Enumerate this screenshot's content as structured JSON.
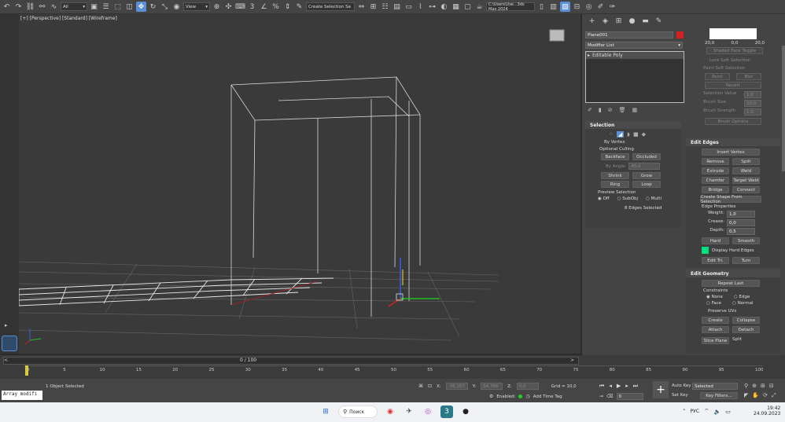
{
  "toolbar": {
    "selection_filter": "All",
    "ref_coord": "View",
    "named_selection": "Create Selection Se",
    "project_path": "C:\\Users\\Use...3ds Max 2024"
  },
  "viewport": {
    "label": "[+] [Perspective] [Standard] [Wireframe]"
  },
  "command_panel": {
    "object_name": "Plane001",
    "object_color": "#d42020",
    "modifier_list": "Modifier List",
    "stack_item": "Editable Poly",
    "selection": {
      "title": "Selection",
      "by_vertex": "By Vertex",
      "optional_culling": "Optional Culling",
      "backface": "Backface",
      "occluded": "Occluded",
      "by_angle": "By Angle:",
      "by_angle_value": "45,0",
      "shrink": "Shrink",
      "grow": "Grow",
      "ring": "Ring",
      "loop": "Loop",
      "preview_selection": "Preview Selection",
      "off": "Off",
      "subobj": "SubObj",
      "multi": "Multi",
      "status": "8 Edges Selected"
    },
    "soft_selection": {
      "values": [
        "20,0",
        "0,0",
        "20,0"
      ],
      "shaded_face_toggle": "Shaded Face Toggle",
      "lock_soft_selection": "Lock Soft Selection",
      "paint_soft_selection": "Paint Soft Selection",
      "paint": "Paint",
      "blur": "Blur",
      "revert": "Revert",
      "selection_value": "Selection Value",
      "selection_value_num": "1,0",
      "brush_size": "Brush Size",
      "brush_size_num": "20,0",
      "brush_strength": "Brush Strength",
      "brush_strength_num": "1,0",
      "brush_options": "Brush Options"
    },
    "edit_edges": {
      "title": "Edit Edges",
      "insert_vertex": "Insert Vertex",
      "remove": "Remove",
      "split": "Split",
      "extrude": "Extrude",
      "weld": "Weld",
      "chamfer": "Chamfer",
      "target_weld": "Target Weld",
      "bridge": "Bridge",
      "connect": "Connect",
      "create_shape": "Create Shape From Selection",
      "edge_properties": "Edge Properties",
      "weight": "Weight:",
      "weight_val": "1,0",
      "crease": "Crease:",
      "crease_val": "0,0",
      "depth": "Depth:",
      "depth_val": "0,5",
      "hard": "Hard",
      "smooth": "Smooth",
      "display_hard_edges": "Display Hard Edges",
      "edit_tri": "Edit Tri.",
      "turn": "Turn"
    },
    "edit_geometry": {
      "title": "Edit Geometry",
      "repeat_last": "Repeat Last",
      "constraints": "Constraints",
      "none": "None",
      "edge": "Edge",
      "face": "Face",
      "normal": "Normal",
      "preserve_uvs": "Preserve UVs",
      "create": "Create",
      "collapse": "Collapse",
      "attach": "Attach",
      "detach": "Detach",
      "slice_plane": "Slice Plane",
      "split": "Split"
    }
  },
  "timeline": {
    "frame": "0 / 100",
    "ticks": [
      "0",
      "5",
      "10",
      "15",
      "20",
      "25",
      "30",
      "35",
      "40",
      "45",
      "50",
      "55",
      "60",
      "65",
      "70",
      "75",
      "80",
      "85",
      "90",
      "95",
      "100"
    ]
  },
  "status": {
    "script_listener": "Array modifi",
    "objects_selected": "1 Object Selected",
    "x_label": "X:",
    "x_val": "-76,157",
    "y_label": "Y:",
    "y_val": "54,766",
    "z_label": "Z:",
    "z_val": "0,0",
    "grid": "Grid = 10,0",
    "enabled": "Enabled:",
    "add_time_tag": "Add Time Tag",
    "auto_key": "Auto Key",
    "set_key": "Set Key",
    "selected": "Selected",
    "key_filters": "Key Filters...",
    "frame_value": "0"
  },
  "taskbar": {
    "search": "Поиск",
    "lang": "РУС",
    "time": "19:42",
    "date": "24.09.2023"
  }
}
